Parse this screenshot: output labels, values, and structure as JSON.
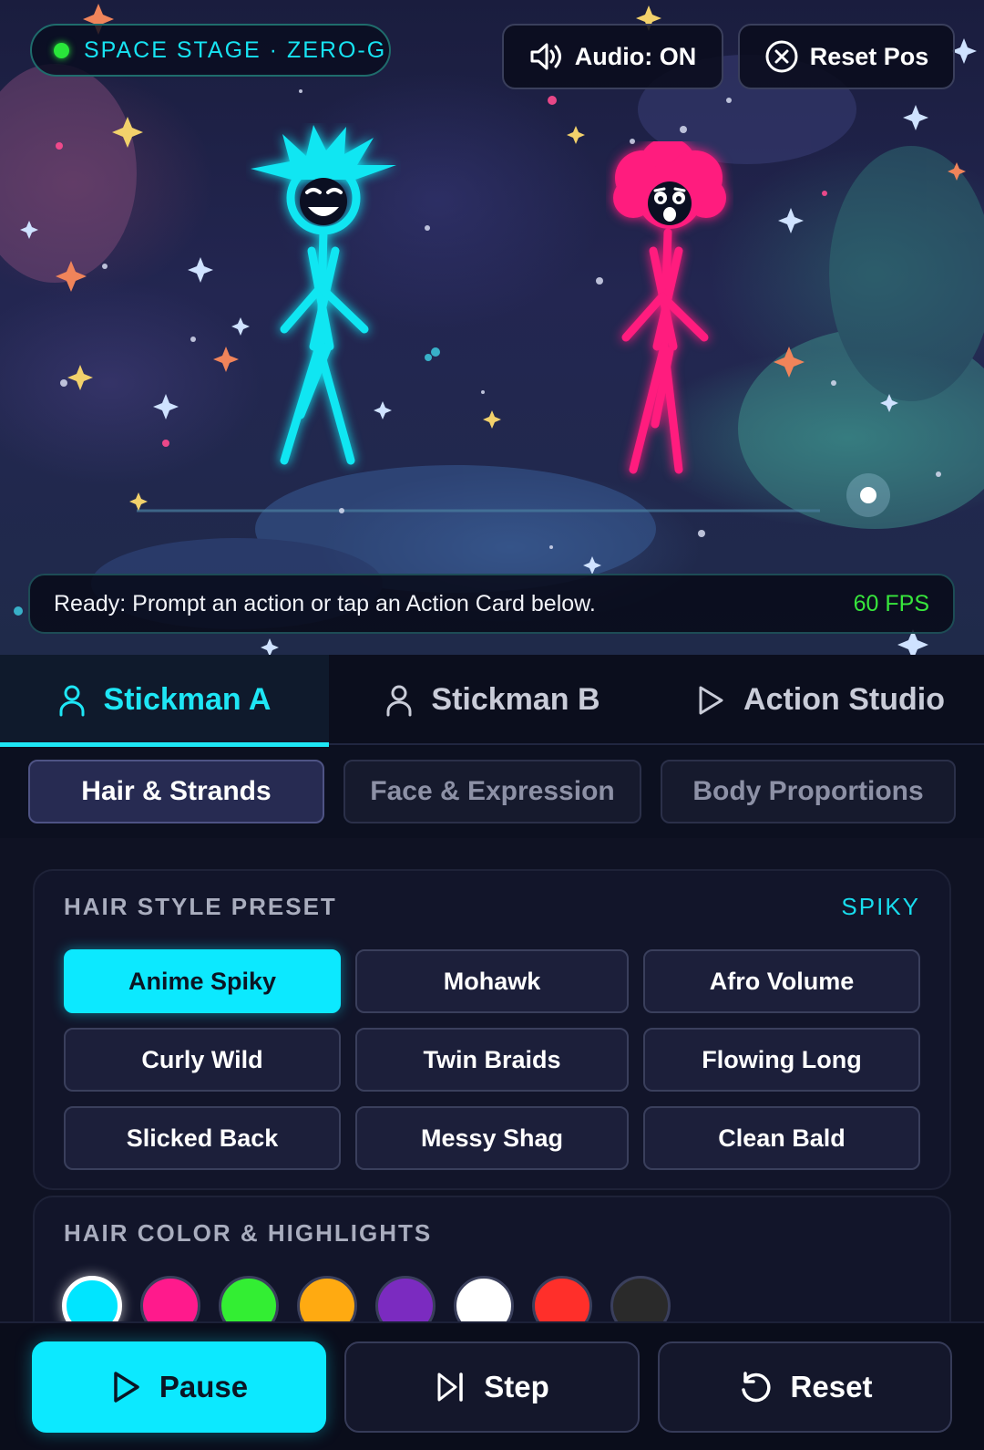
{
  "stage": {
    "badge": "SPACE STAGE · ZERO-G",
    "audio_button": "Audio: ON",
    "reset_pos_button": "Reset Pos",
    "status_message": "Ready: Prompt an action or tap an Action Card below.",
    "fps": "60 FPS"
  },
  "tabs": [
    {
      "label": "Stickman A",
      "icon": "person-icon",
      "active": true
    },
    {
      "label": "Stickman B",
      "icon": "person-icon",
      "active": false
    },
    {
      "label": "Action Studio",
      "icon": "play-icon",
      "active": false
    }
  ],
  "subtabs": [
    {
      "label": "Hair & Strands",
      "active": true
    },
    {
      "label": "Face & Expression",
      "active": false
    },
    {
      "label": "Body Proportions",
      "active": false
    }
  ],
  "hair_style": {
    "title": "HAIR STYLE PRESET",
    "current": "SPIKY",
    "presets": [
      "Anime Spiky",
      "Mohawk",
      "Afro Volume",
      "Curly Wild",
      "Twin Braids",
      "Flowing Long",
      "Slicked Back",
      "Messy Shag",
      "Clean Bald"
    ],
    "selected_index": 0
  },
  "hair_color": {
    "title": "HAIR COLOR & HIGHLIGHTS",
    "swatches": [
      "#00e5ff",
      "#ff1a8c",
      "#33ee33",
      "#ffaa11",
      "#7b2bc0",
      "#ffffff",
      "#ff2f2a",
      "#2a2a2a"
    ],
    "selected_index": 0
  },
  "controls": {
    "pause": "Pause",
    "step": "Step",
    "reset": "Reset"
  },
  "colors": {
    "accent": "#0ce9ff",
    "stickman_a": "#10e6f2",
    "stickman_b": "#ff1c7e",
    "fps_green": "#37e53c"
  }
}
